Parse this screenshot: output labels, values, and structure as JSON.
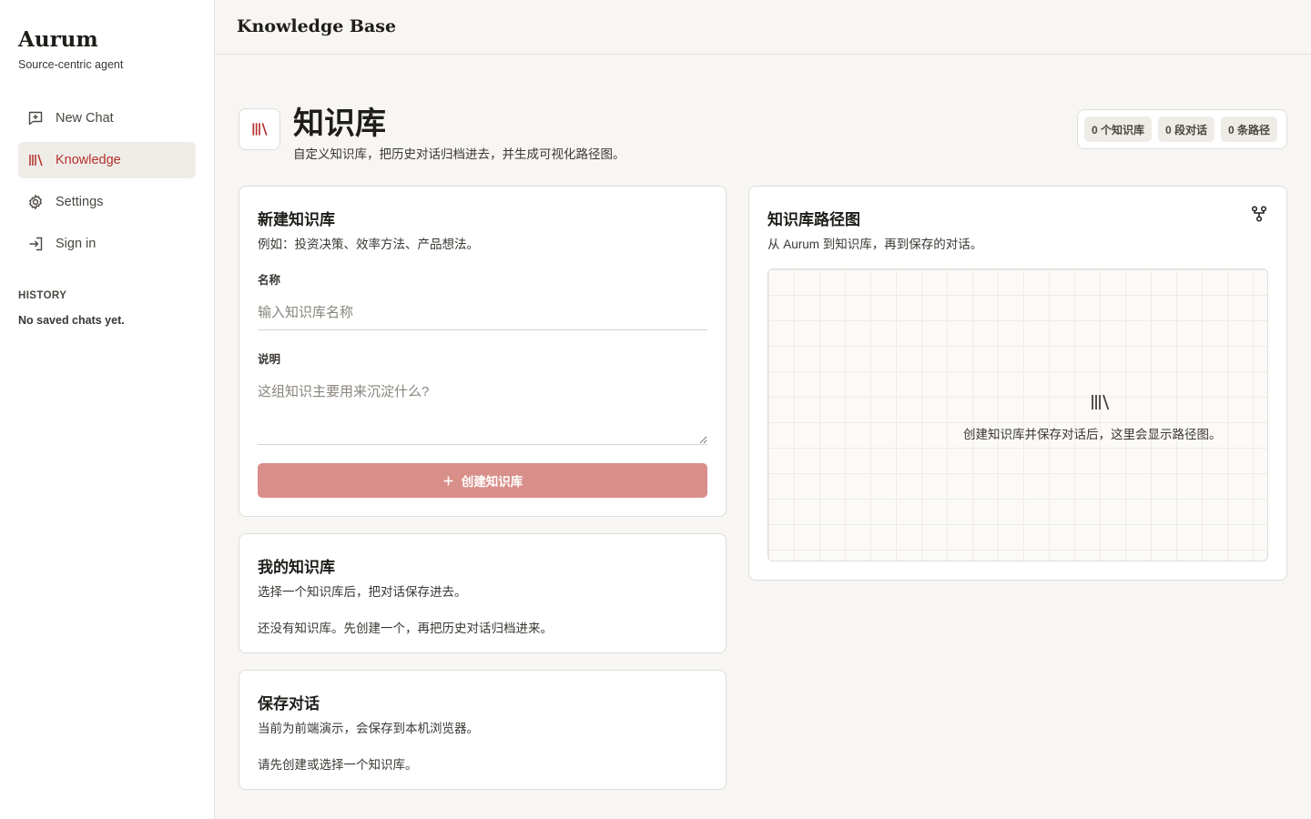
{
  "sidebar": {
    "brand": "Aurum",
    "tagline": "Source-centric agent",
    "items": [
      {
        "label": "New Chat",
        "icon": "chat-plus-icon"
      },
      {
        "label": "Knowledge",
        "icon": "library-icon"
      },
      {
        "label": "Settings",
        "icon": "gear-icon"
      },
      {
        "label": "Sign in",
        "icon": "sign-in-icon"
      }
    ],
    "history_title": "HISTORY",
    "history_empty": "No saved chats yet."
  },
  "topbar": {
    "title": "Knowledge Base"
  },
  "header": {
    "title": "知识库",
    "subtitle": "自定义知识库，把历史对话归档进去，并生成可视化路径图。",
    "stats": [
      "0 个知识库",
      "0 段对话",
      "0 条路径"
    ]
  },
  "create_card": {
    "title": "新建知识库",
    "desc": "例如：投资决策、效率方法、产品想法。",
    "name_label": "名称",
    "name_placeholder": "输入知识库名称",
    "desc_label": "说明",
    "desc_placeholder": "这组知识主要用来沉淀什么?",
    "button_label": "创建知识库"
  },
  "my_card": {
    "title": "我的知识库",
    "desc": "选择一个知识库后，把对话保存进去。",
    "empty": "还没有知识库。先创建一个，再把历史对话归档进来。"
  },
  "save_card": {
    "title": "保存对话",
    "desc": "当前为前端演示，会保存到本机浏览器。",
    "empty": "请先创建或选择一个知识库。"
  },
  "graph_card": {
    "title": "知识库路径图",
    "desc": "从 Aurum 到知识库，再到保存的对话。",
    "empty": "创建知识库并保存对话后，这里会显示路径图。"
  },
  "colors": {
    "accent": "#b5302a",
    "button": "#d98f89"
  }
}
